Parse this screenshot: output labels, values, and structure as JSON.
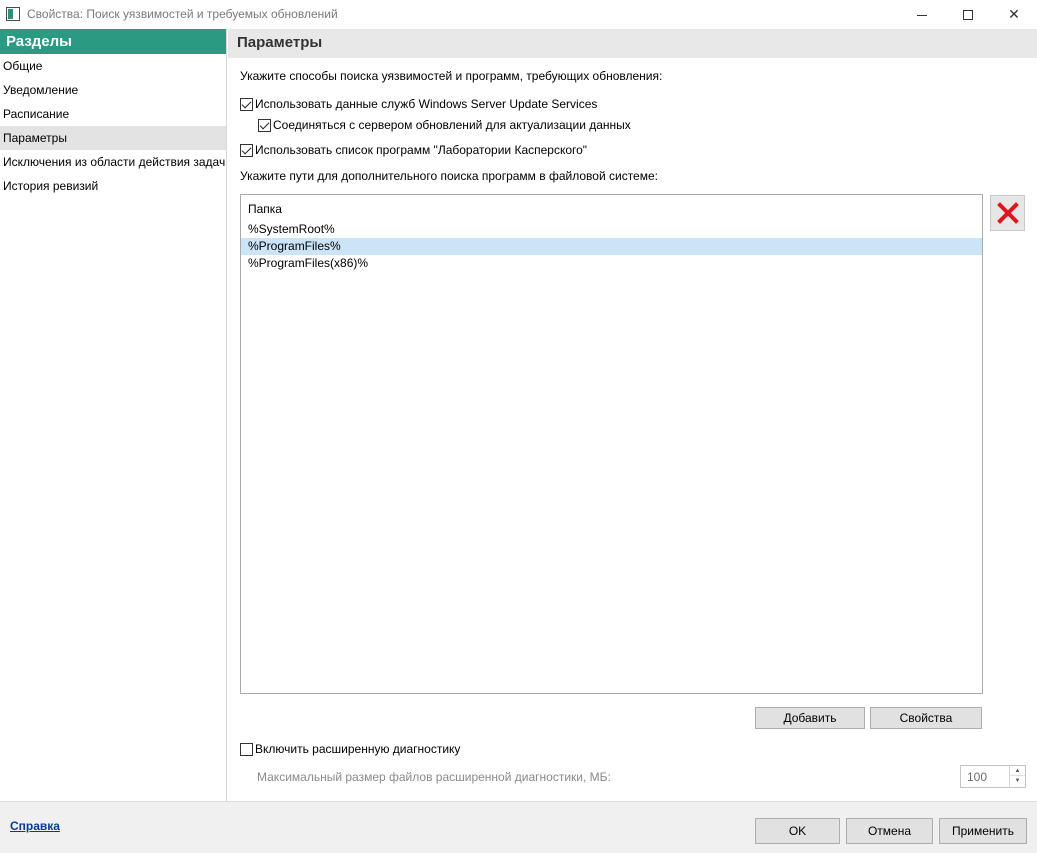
{
  "window": {
    "title": "Свойства: Поиск уязвимостей и требуемых обновлений",
    "icon": "app-window-icon"
  },
  "sidebar": {
    "header": "Разделы",
    "items": [
      {
        "label": "Общие",
        "selected": false
      },
      {
        "label": "Уведомление",
        "selected": false
      },
      {
        "label": "Расписание",
        "selected": false
      },
      {
        "label": "Параметры",
        "selected": true
      },
      {
        "label": "Исключения из области действия задачи",
        "selected": false
      },
      {
        "label": "История ревизий",
        "selected": false
      }
    ]
  },
  "main": {
    "title": "Параметры",
    "intro": "Укажите способы поиска уязвимостей и программ, требующих обновления:",
    "options": {
      "wsus": {
        "label": "Использовать данные служб Windows Server Update Services",
        "checked": true
      },
      "connect_server": {
        "label": "Соединяться с сервером обновлений для актуализации данных",
        "checked": true
      },
      "kaspersky_list": {
        "label": "Использовать список программ \"Лаборатории Касперского\"",
        "checked": true
      }
    },
    "paths_label": "Укажите пути для дополнительного поиска программ в файловой системе:",
    "folders": {
      "column_header": "Папка",
      "rows": [
        {
          "value": "%SystemRoot%",
          "selected": false
        },
        {
          "value": "%ProgramFiles%",
          "selected": true
        },
        {
          "value": "%ProgramFiles(x86)%",
          "selected": false
        }
      ]
    },
    "add_button": "Добавить",
    "properties_button": "Свойства",
    "diagnostics": {
      "label": "Включить расширенную диагностику",
      "checked": false,
      "max_size_label": "Максимальный размер файлов расширенной диагностики, МБ:",
      "max_size_value": "100"
    }
  },
  "footer": {
    "help": "Справка",
    "ok": "OK",
    "cancel": "Отмена",
    "apply": "Применить"
  },
  "colors": {
    "accent": "#2a9a83",
    "selection": "#cce4f7",
    "delete_icon": "#e0141e",
    "link": "#0a3b92"
  }
}
